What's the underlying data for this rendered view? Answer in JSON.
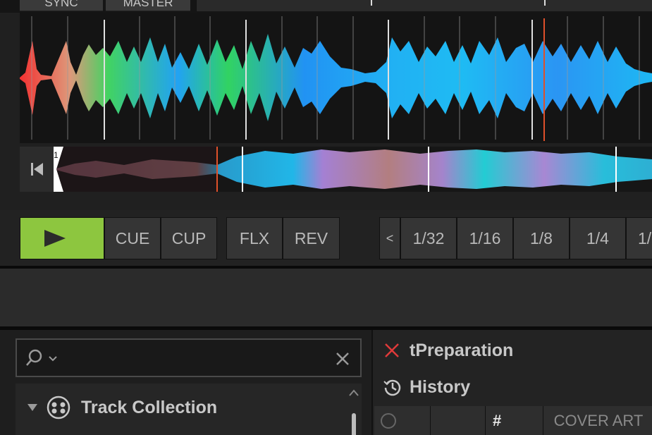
{
  "deck": {
    "sync_label": "SYNC",
    "master_label": "MASTER",
    "overview_start_marker": "1"
  },
  "transport": {
    "cue_label": "CUE",
    "cup_label": "CUP",
    "flx_label": "FLX",
    "rev_label": "REV",
    "loop_prev": "<",
    "loop_sizes": [
      "1/32",
      "1/16",
      "1/8",
      "1/4",
      "1/"
    ]
  },
  "browser": {
    "search_placeholder": "",
    "tree": {
      "item_label": "Track Collection"
    },
    "playlists": [
      {
        "label": "tPreparation"
      },
      {
        "label": "History"
      }
    ],
    "columns": [
      "",
      "",
      "#",
      "COVER ART"
    ]
  },
  "colors": {
    "accent_play": "#8dc63f",
    "playhead": "#e0502a",
    "remove": "#e03a3a"
  }
}
